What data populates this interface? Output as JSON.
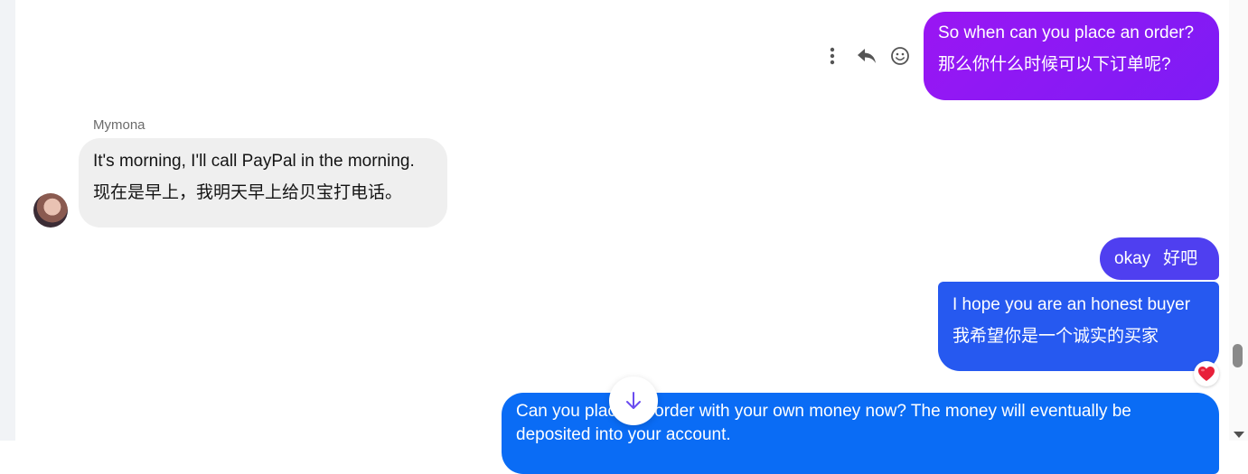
{
  "messages": [
    {
      "direction": "outgoing",
      "lines": [
        "So when can you place an order?",
        "那么你什么时候可以下订单呢?"
      ],
      "color": "#8e18f4"
    },
    {
      "direction": "incoming",
      "sender": "Mymona",
      "lines": [
        "It's morning, I'll call PayPal in the morning.",
        "现在是早上，我明天早上给贝宝打电话。"
      ],
      "color": "#efefef"
    },
    {
      "direction": "outgoing",
      "lines": [
        "okay",
        "好吧"
      ],
      "color": "#4f3ff0"
    },
    {
      "direction": "outgoing",
      "lines": [
        "I hope you are an honest buyer",
        "我希望你是一个诚实的买家"
      ],
      "reaction": "heart",
      "color": "#2659f0"
    },
    {
      "direction": "outgoing",
      "text": "Can you place an order with your own money now? The money will eventually be deposited into your account.",
      "color": "#0a6cf5"
    }
  ],
  "message_actions": {
    "icons": [
      "more-vertical-icon",
      "reply-icon",
      "emoji-icon"
    ]
  },
  "scroll_down_icon": "arrow-down-icon",
  "accent": "#6a4cf0"
}
